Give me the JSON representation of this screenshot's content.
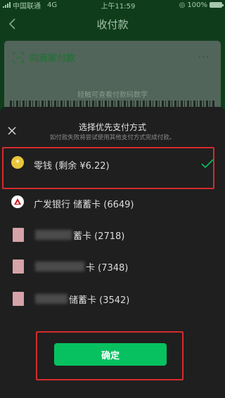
{
  "status": {
    "carrier": "中国联通",
    "network": "4G",
    "time": "上午11:59",
    "battery": "100%",
    "battery_level": 1.0
  },
  "header": {
    "title": "收付款"
  },
  "card": {
    "title": "向商家付款",
    "menu": "···",
    "hint": "轻触可查看付款码数字"
  },
  "sheet": {
    "title": "选择优先支付方式",
    "subtitle": "如付款失败将尝试使用其他支付方式完成付款。",
    "methods": [
      {
        "label": "零钱 (剩余 ¥6.22)",
        "icon": "coin-icon",
        "selected": true
      },
      {
        "label": "广发银行 储蓄卡 (6649)",
        "icon": "bank-logo-icon",
        "selected": false
      },
      {
        "label": "蓄卡 (2718)",
        "icon": "bank-card-icon",
        "selected": false
      },
      {
        "label": "卡 (7348)",
        "icon": "bank-card-icon",
        "selected": false
      },
      {
        "label": "储蓄卡 (3542)",
        "icon": "bank-card-icon",
        "selected": false
      }
    ],
    "confirm": "确定"
  },
  "colors": {
    "accent": "#07c160",
    "highlight": "#d52b2b",
    "coin": "#e8c63c"
  }
}
